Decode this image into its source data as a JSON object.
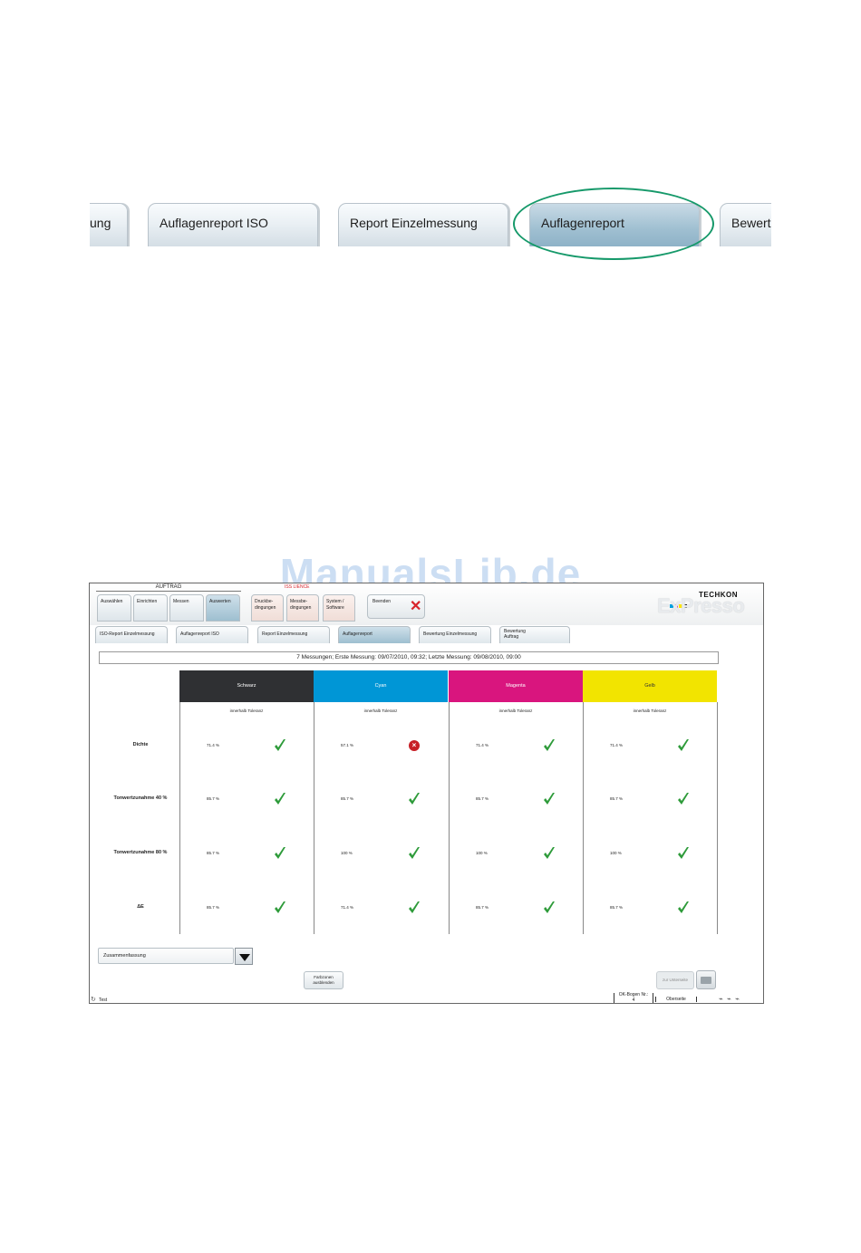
{
  "zoom_tabs": [
    {
      "label": "sung",
      "active": false
    },
    {
      "label": "Auflagenreport ISO",
      "active": false
    },
    {
      "label": "Report Einzelmessung",
      "active": false
    },
    {
      "label": "Auflagenreport",
      "active": true
    },
    {
      "label": "Bewert",
      "active": false
    }
  ],
  "watermark": "ManualsLib.de",
  "app": {
    "group_title": "AUFTRAG",
    "menu": [
      {
        "label": "Auswählen"
      },
      {
        "label": "Einrichten"
      },
      {
        "label": "Messen"
      },
      {
        "label": "Auswerten",
        "active": true
      },
      {
        "label": "Druckbe-\ndingungen"
      },
      {
        "label": "Messbe-\ndingungen"
      },
      {
        "label": "System /\nSoftware"
      }
    ],
    "red_label": "ISS      LIENCE",
    "exit_label": "Beenden",
    "logo": {
      "brand": "TECHKON",
      "product": "ExPresso"
    },
    "tabs": [
      {
        "label": "ISO-Report Einzelmessung"
      },
      {
        "label": "Auflagenreport ISO"
      },
      {
        "label": "Report Einzelmessung"
      },
      {
        "label": "Auflagenreport",
        "active": true
      },
      {
        "label": "Bewertung Einzelmessung"
      },
      {
        "label": "Bewertung\nAuftrag"
      }
    ],
    "summary": "7 Messungen;  Erste Messung: 09/07/2010, 09:32;  Letzte Messung: 09/08/2010, 09:00",
    "columns": [
      {
        "name": "Schwarz",
        "color": "#2f3033",
        "text_color": "#ffffff",
        "tolerance": "innerhalb Toleranz"
      },
      {
        "name": "Cyan",
        "color": "#0096d6",
        "text_color": "#ffffff",
        "tolerance": "innerhalb Toleranz"
      },
      {
        "name": "Magenta",
        "color": "#d9157e",
        "text_color": "#ffffff",
        "tolerance": "innerhalb Toleranz"
      },
      {
        "name": "Gelb",
        "color": "#f2e400",
        "text_color": "#333333",
        "tolerance": "innerhalb Toleranz"
      }
    ],
    "rows": [
      {
        "label": "Dichte",
        "values": [
          "71.4 %",
          "57.1 %",
          "71.4 %",
          "71.4 %"
        ],
        "ok": [
          true,
          false,
          true,
          true
        ]
      },
      {
        "label": "Tonwertzunahme 40 %",
        "values": [
          "85.7 %",
          "85.7 %",
          "85.7 %",
          "85.7 %"
        ],
        "ok": [
          true,
          true,
          true,
          true
        ]
      },
      {
        "label": "Tonwertzunahme 80 %",
        "values": [
          "85.7 %",
          "100 %",
          "100 %",
          "100 %"
        ],
        "ok": [
          true,
          true,
          true,
          true
        ]
      },
      {
        "label": "ΔE",
        "values": [
          "85.7 %",
          "71.4 %",
          "85.7 %",
          "85.7 %"
        ],
        "ok": [
          true,
          true,
          true,
          true
        ]
      }
    ],
    "dropdown_value": "Zusammenfassung",
    "farbzonen_label": "Farbzonen\nausblenden",
    "zur_unterseite_label": "zur Unterseite",
    "status": {
      "text": "Test",
      "ok_bogen_label": "OK-Bogen Nr.:",
      "ok_bogen_value": "4",
      "side": "Oberseite"
    },
    "colors": {
      "check": "#2e9b3a",
      "error": "#c71f26",
      "accent": "#9ebfd0"
    }
  }
}
